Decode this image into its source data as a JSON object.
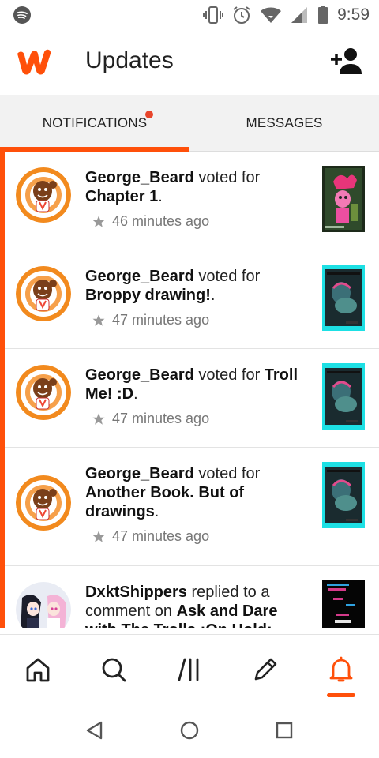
{
  "status_bar": {
    "time": "9:59",
    "left_icon": "spotify-icon",
    "right_icons": [
      "vibrate-icon",
      "alarm-icon",
      "wifi-icon",
      "signal-icon",
      "battery-icon"
    ]
  },
  "app_bar": {
    "title": "Updates",
    "logo_icon": "wattpad-logo",
    "action_icon": "add-user-icon"
  },
  "tabs": [
    {
      "label": "NOTIFICATIONS",
      "active": true,
      "has_badge": true
    },
    {
      "label": "MESSAGES",
      "active": false,
      "has_badge": false
    }
  ],
  "notifications": [
    {
      "user": "George_Beard",
      "action": " voted for ",
      "target": "Chapter 1",
      "suffix": ".",
      "time": "46 minutes ago"
    },
    {
      "user": "George_Beard",
      "action": " voted for ",
      "target": "Broppy drawing!",
      "suffix": ".",
      "time": "47 minutes ago"
    },
    {
      "user": "George_Beard",
      "action": " voted for ",
      "target": "Troll Me! :D",
      "suffix": ".",
      "time": "47 minutes ago"
    },
    {
      "user": "George_Beard",
      "action": " voted for ",
      "target": "Another Book. But of drawings",
      "suffix": ".",
      "time": "47 minutes ago"
    },
    {
      "user": "DxktShippers",
      "action": " replied to a comment on ",
      "target": "Ask and Dare with The Trolls :On Hold:",
      "suffix": "",
      "time": ""
    }
  ],
  "bottom_nav": {
    "items": [
      "home-icon",
      "search-icon",
      "library-icon",
      "write-icon",
      "notifications-icon"
    ],
    "active": "notifications-icon"
  },
  "system_nav": [
    "back-icon",
    "home-circle-icon",
    "recents-icon"
  ],
  "colors": {
    "accent": "#ff500a",
    "badge": "#e8452b",
    "tab_bg": "#f2f2f2"
  }
}
